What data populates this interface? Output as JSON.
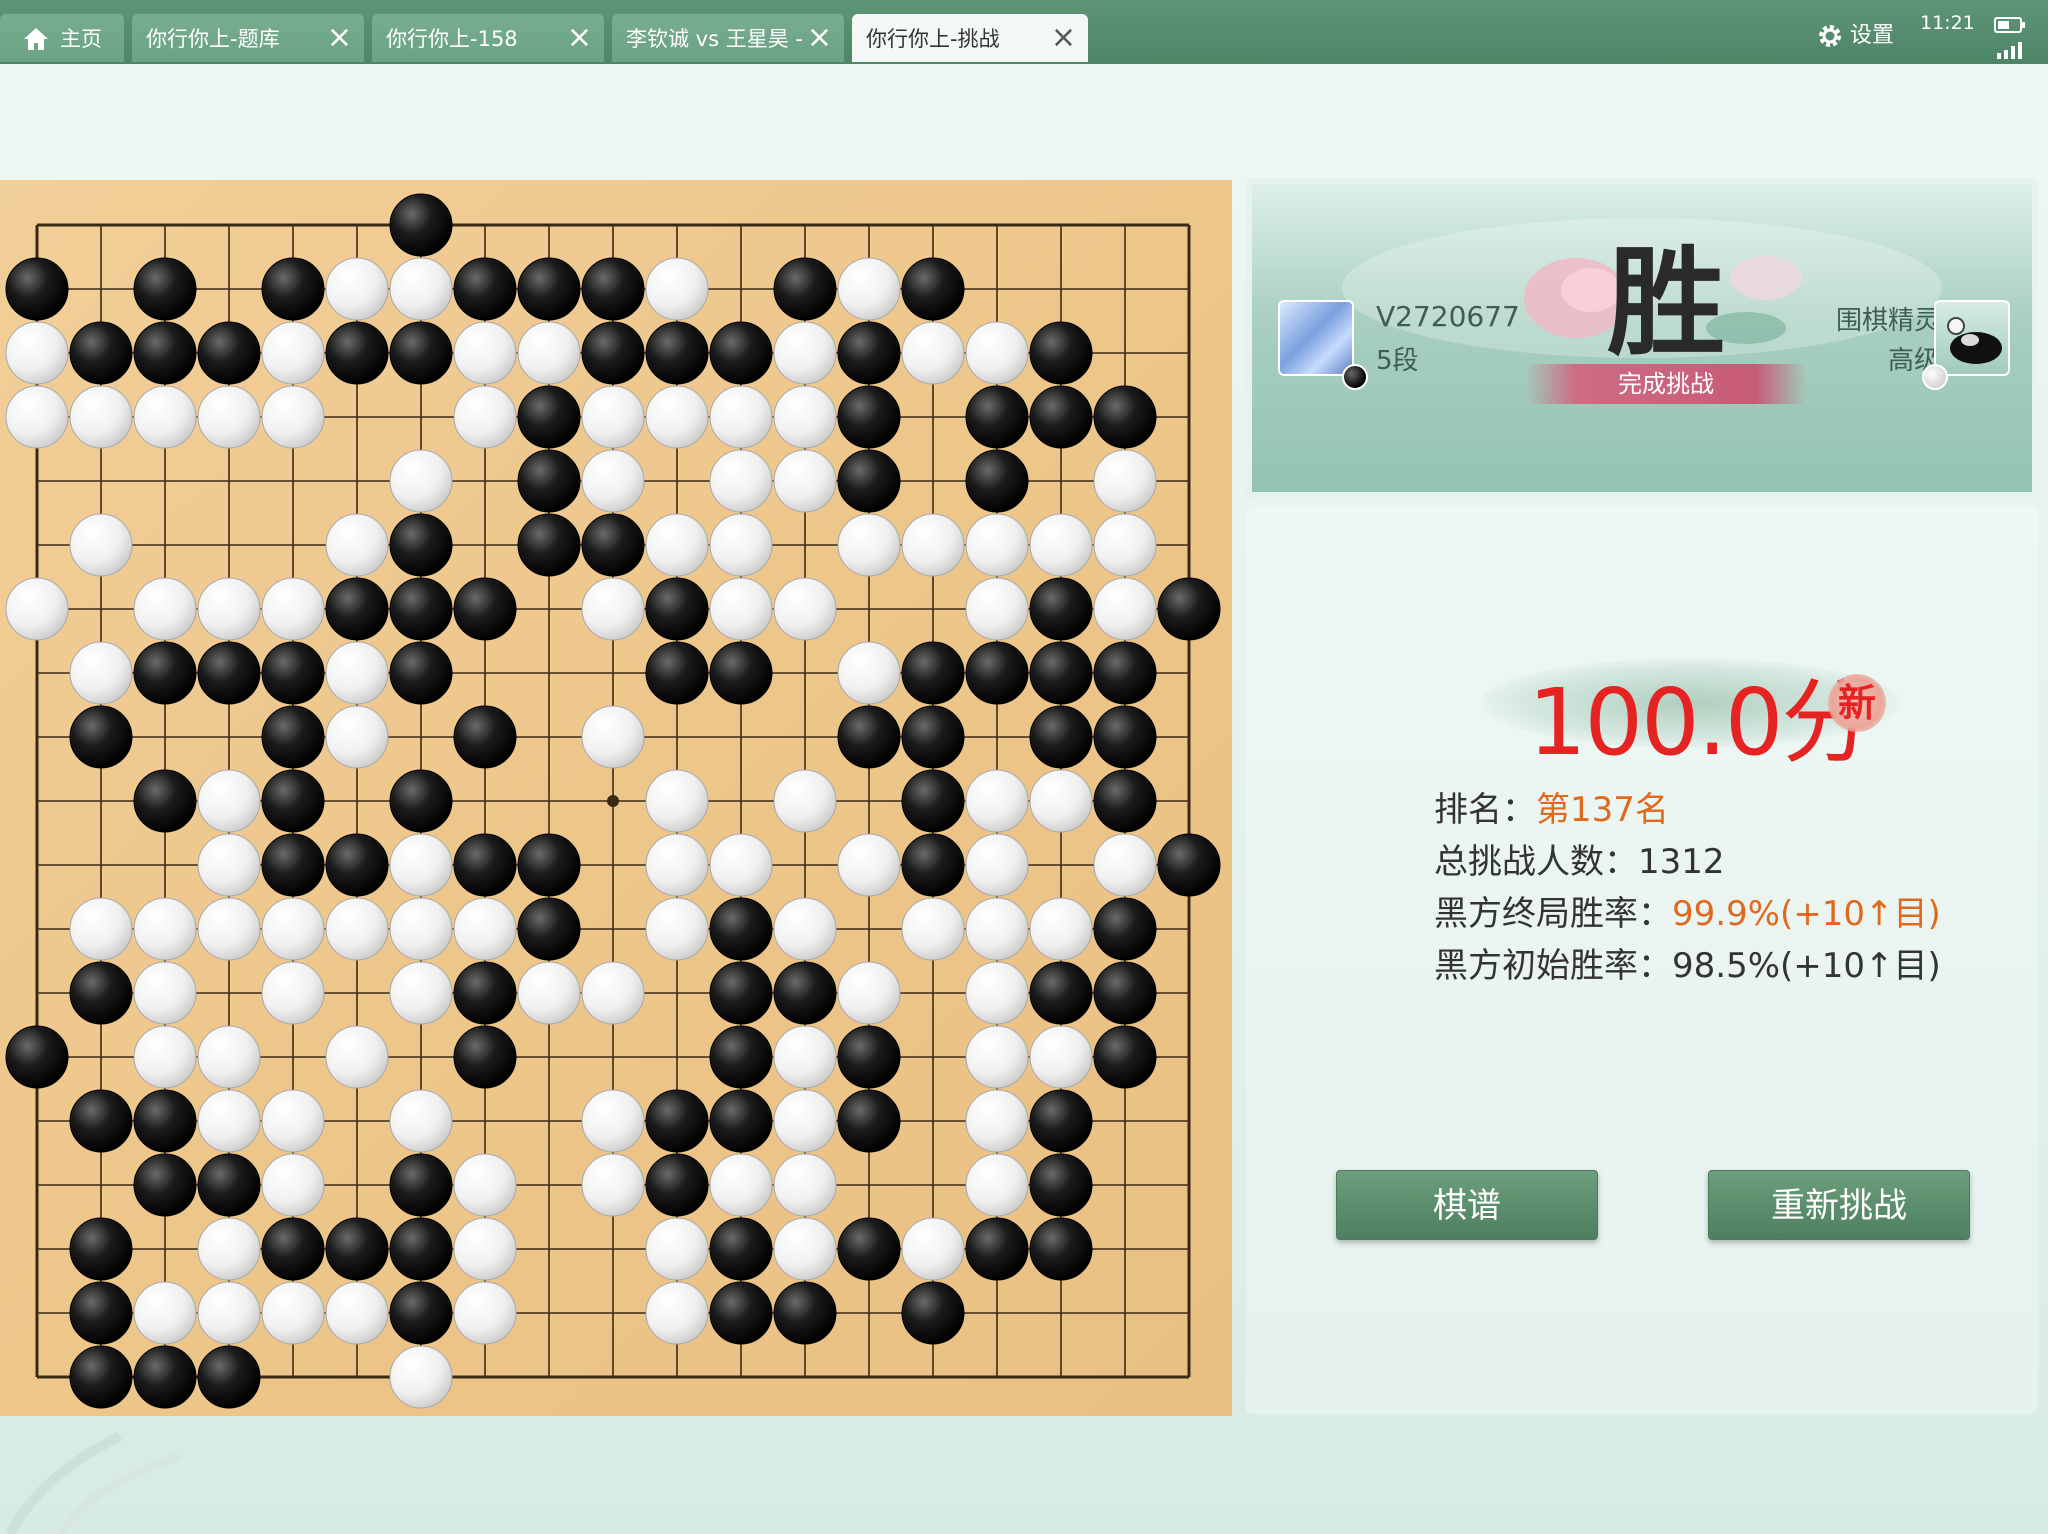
{
  "tabs": [
    {
      "label": "主页",
      "icon": "home-icon"
    },
    {
      "label": "你行你上-题库"
    },
    {
      "label": "你行你上-158"
    },
    {
      "label": "李钦诚 vs 王星昊 -"
    },
    {
      "label": "你行你上-挑战",
      "active": true
    }
  ],
  "status": {
    "settings_label": "设置",
    "time": "11:21"
  },
  "board": {
    "size": 19,
    "last_move": [
      9,
      8
    ],
    "rows": [
      "......B............",
      "B.B.BWWBBBW.BWB....",
      "WBBBWBBWWBBBWBWWB..",
      "WWWWW..WBWWWWB.BBB.",
      "......W.BW.WWB.B.W.",
      ".W...WB.BBWW.WWWWW.",
      "W.WWWBBB.WBWW..WBWB",
      ".WBBBWB...BB.WBBBB.",
      ".B..BW.B.W...BB.BB.",
      "..BWB.B...W.W.BWWB.",
      "...WBBWBB.WW.WBW.WB",
      ".WWWWWWWB.WBW.WWWB.",
      ".BW.W.WBWW.BBW.WBB.",
      "B.WW.W.B...BWB.WWB.",
      ".BBWW.W..WBBWB.WB..",
      "..BBW.BW.WBWW..WB..",
      ".B.WBBBW..WBWBWBB..",
      ".BWWWWBW..WBB.B....",
      ".BBB..W............"
    ]
  },
  "result": {
    "player": {
      "name": "V2720677",
      "rank": "5段"
    },
    "opponent": {
      "name": "围棋精灵",
      "level": "高级"
    },
    "outcome_char": "胜",
    "outcome_sub": "完成挑战"
  },
  "score": {
    "value": "100.0分",
    "badge": "新"
  },
  "stats": {
    "rank_label": "排名：",
    "rank_value": "第137名",
    "total_label": "总挑战人数：",
    "total_value": "1312",
    "final_label": "黑方终局胜率：",
    "final_value": "99.9%(+10↑目)",
    "initial_label": "黑方初始胜率：",
    "initial_value": "98.5%(+10↑目)"
  },
  "buttons": {
    "record": "棋谱",
    "retry": "重新挑战"
  }
}
